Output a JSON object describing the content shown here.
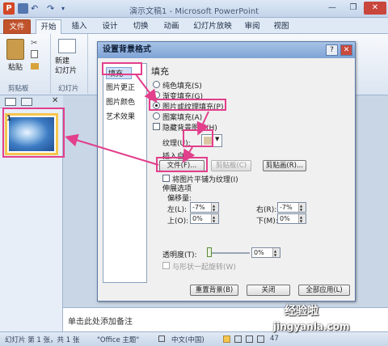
{
  "app": {
    "title": "演示文稿1 - Microsoft PowerPoint",
    "icon_letter": "P"
  },
  "window_controls": {
    "minimize": "—",
    "restore": "❐",
    "close": "✕"
  },
  "ribbon_tabs": [
    "文件",
    "开始",
    "插入",
    "设计",
    "切换",
    "动画",
    "幻灯片放映",
    "审阅",
    "视图"
  ],
  "ribbon": {
    "paste_label": "粘贴",
    "clipboard_group": "剪贴板",
    "new_slide_label": "新建\n幻灯片",
    "slides_group": "幻灯片"
  },
  "slide_panel": {
    "slide_number": "1",
    "close_glyph": "✕"
  },
  "notes": {
    "placeholder": "单击此处添加备注"
  },
  "statusbar": {
    "slide_info": "幻灯片 第 1 张，共 1 张",
    "theme": "\"Office 主题\"",
    "language": "中文(中国)",
    "zoom": "47"
  },
  "dialog": {
    "title": "设置背景格式",
    "help": "?",
    "close": "✕",
    "categories": [
      "填充",
      "图片更正",
      "图片颜色",
      "艺术效果"
    ],
    "section_heading": "填充",
    "radio_options": [
      "纯色填充(S)",
      "渐变填充(G)",
      "图片或纹理填充(P)",
      "图案填充(A)"
    ],
    "selected_option": "图片或纹理填充(P)",
    "hide_bg_graphics": "隐藏背景图形(H)",
    "texture_label": "纹理(U):",
    "insert_from_label": "插入自:",
    "file_button": "文件(F)...",
    "clipboard_button": "剪贴板(C)",
    "clipart_button": "剪贴画(R)...",
    "tile_checkbox": "将图片平铺为纹理(I)",
    "stretch_options": "伸展选项",
    "offsets_label": "偏移量:",
    "offsets": {
      "left_label": "左(L):",
      "left_value": "-7%",
      "right_label": "右(R):",
      "right_value": "-7%",
      "top_label": "上(O):",
      "top_value": "0%",
      "bottom_label": "下(M):",
      "bottom_value": "0%"
    },
    "transparency_label": "透明度(T):",
    "transparency_value": "0%",
    "rotate_with_shape": "与形状一起旋转(W)",
    "reset_button": "重置背景(B)",
    "close_button": "关闭",
    "apply_all_button": "全部应用(L)"
  },
  "watermark": {
    "brand": "经验啦",
    "url": "jingyanla.com"
  },
  "colors": {
    "highlight": "#e23f8c",
    "file_tab": "#c0532c",
    "accent": "#7ea3d6"
  }
}
